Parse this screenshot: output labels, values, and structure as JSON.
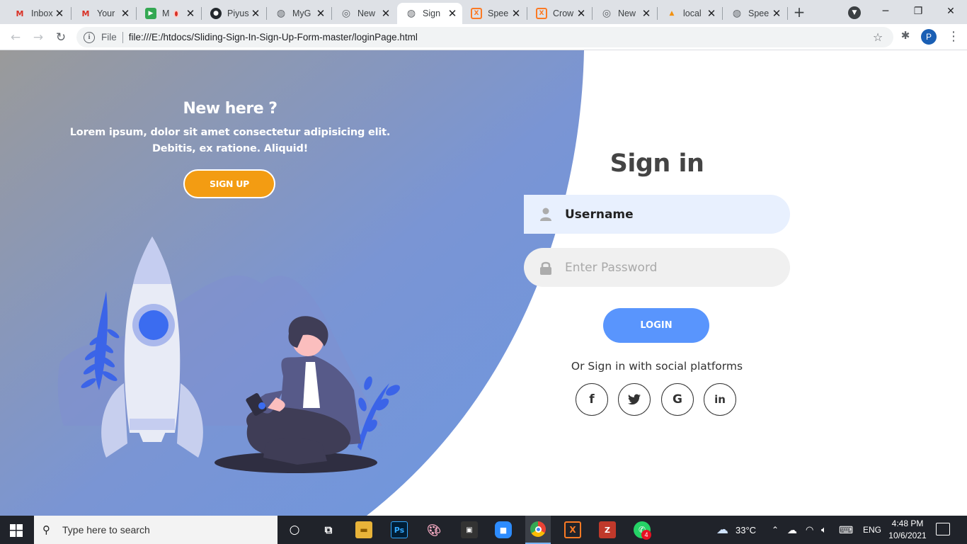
{
  "browser": {
    "tabs": [
      {
        "label": "Inbox",
        "icon": "gmail-icon",
        "active": false
      },
      {
        "label": "Your",
        "icon": "gmail-icon",
        "active": false
      },
      {
        "label": "M",
        "icon": "meet-icon",
        "active": false,
        "recording": true
      },
      {
        "label": "Piyus",
        "icon": "github-icon",
        "active": false
      },
      {
        "label": "MyG",
        "icon": "globe-icon",
        "active": false
      },
      {
        "label": "New",
        "icon": "chrome-icon",
        "active": false
      },
      {
        "label": "Sign",
        "icon": "globe-icon",
        "active": true
      },
      {
        "label": "Spee",
        "icon": "xampp-icon",
        "active": false
      },
      {
        "label": "Crow",
        "icon": "xampp-icon",
        "active": false
      },
      {
        "label": "New",
        "icon": "chrome-icon",
        "active": false
      },
      {
        "label": "local",
        "icon": "phpmyadmin-icon",
        "active": false
      },
      {
        "label": "Spee",
        "icon": "globe-icon",
        "active": false
      }
    ],
    "new_tab": "+",
    "omnibox": {
      "scheme_label": "File",
      "url": "file:///E:/htdocs/Sliding-Sign-In-Sign-Up-Form-master/loginPage.html"
    },
    "profile_initial": "P"
  },
  "left_panel": {
    "heading": "New here ?",
    "description": "Lorem ipsum, dolor sit amet consectetur adipisicing elit. Debitis, ex ratione. Aliquid!",
    "signup_button": "SIGN UP"
  },
  "signin_form": {
    "title": "Sign in",
    "username_value": "Username",
    "password_placeholder": "Enter Password",
    "login_button": "LOGIN",
    "social_text": "Or Sign in with social platforms",
    "social_buttons": [
      {
        "label": "f",
        "icon": "facebook-icon"
      },
      {
        "label": "t",
        "icon": "twitter-icon"
      },
      {
        "label": "G",
        "icon": "google-icon"
      },
      {
        "label": "in",
        "icon": "linkedin-icon"
      }
    ]
  },
  "taskbar": {
    "search_placeholder": "Type here to search",
    "weather": "33°C",
    "language": "ENG",
    "time": "4:48 PM",
    "date": "10/6/2021",
    "whatsapp_badge": "4"
  },
  "colors": {
    "panel_gradient_start": "#9a9a9a",
    "panel_gradient_end": "#6d96e0",
    "signup_button": "#f39c12",
    "login_button": "#5995fd",
    "title_text": "#444444"
  }
}
